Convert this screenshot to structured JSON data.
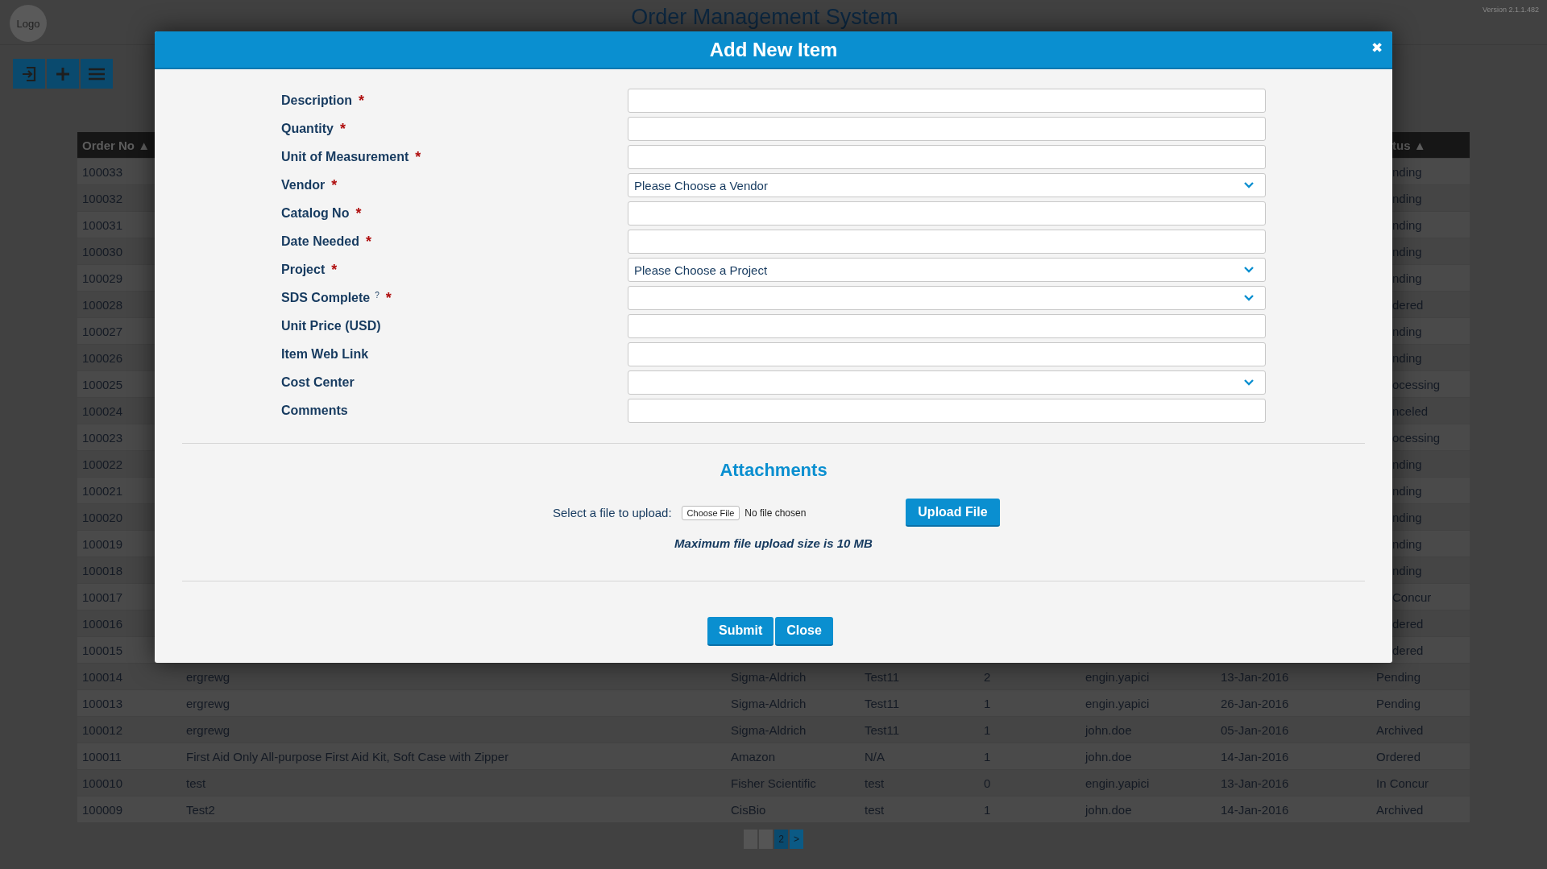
{
  "header": {
    "logo": "Logo",
    "title": "Order Management System",
    "version": "Version 2.1.1.482"
  },
  "toolbar": [
    {
      "kind": "login"
    },
    {
      "kind": "add"
    },
    {
      "kind": "menu"
    }
  ],
  "table": {
    "columns": [
      {
        "label": "Order No",
        "sort": "▲"
      },
      {
        "label": "tus",
        "sort": "▲"
      }
    ],
    "rows": [
      {
        "kind": "covered",
        "order_no": "100033",
        "status": "nding"
      },
      {
        "kind": "covered",
        "order_no": "100032",
        "status": "nding"
      },
      {
        "kind": "covered",
        "order_no": "100031",
        "status": "nding"
      },
      {
        "kind": "covered",
        "order_no": "100030",
        "status": "nding"
      },
      {
        "kind": "covered",
        "order_no": "100029",
        "status": "nding"
      },
      {
        "kind": "covered",
        "order_no": "100028",
        "status": "dered"
      },
      {
        "kind": "covered",
        "order_no": "100027",
        "status": "nding"
      },
      {
        "kind": "covered",
        "order_no": "100026",
        "status": "nding"
      },
      {
        "kind": "covered",
        "order_no": "100025",
        "status": "ocessing"
      },
      {
        "kind": "covered",
        "order_no": "100024",
        "status": "nceled"
      },
      {
        "kind": "covered",
        "order_no": "100023",
        "status": "ocessing"
      },
      {
        "kind": "covered",
        "order_no": "100022",
        "status": "nding"
      },
      {
        "kind": "covered",
        "order_no": "100021",
        "status": "nding"
      },
      {
        "kind": "covered",
        "order_no": "100020",
        "status": "nding"
      },
      {
        "kind": "covered",
        "order_no": "100019",
        "status": "nding"
      },
      {
        "kind": "covered",
        "order_no": "100018",
        "status": "nding"
      },
      {
        "kind": "covered",
        "order_no": "100017",
        "status": "Concur"
      },
      {
        "kind": "covered",
        "order_no": "100016",
        "status": "dered"
      },
      {
        "kind": "covered",
        "order_no": "100015",
        "status": "dered"
      },
      {
        "kind": "full",
        "cells": [
          "100014",
          "ergrewg",
          "Sigma-Aldrich",
          "Test11",
          "2",
          "engin.yapici",
          "13-Jan-2016",
          "Pending"
        ]
      },
      {
        "kind": "full",
        "cells": [
          "100013",
          "ergrewg",
          "Sigma-Aldrich",
          "Test11",
          "1",
          "engin.yapici",
          "26-Jan-2016",
          "Pending"
        ]
      },
      {
        "kind": "full",
        "cells": [
          "100012",
          "ergrewg",
          "Sigma-Aldrich",
          "Test11",
          "1",
          "john.doe",
          "05-Jan-2016",
          "Archived"
        ]
      },
      {
        "kind": "full",
        "cells": [
          "100011",
          "First Aid Only All-purpose First Aid Kit, Soft Case with Zipper",
          "Amazon",
          "N/A",
          "1",
          "john.doe",
          "14-Jan-2016",
          "Ordered"
        ]
      },
      {
        "kind": "full",
        "cells": [
          "100010",
          "test",
          "Fisher Scientific",
          "test",
          "0",
          "engin.yapici",
          "13-Jan-2016",
          "In Concur"
        ]
      },
      {
        "kind": "full",
        "cells": [
          "100009",
          "Test2",
          "CisBio",
          "test",
          "1",
          "john.doe",
          "14-Jan-2016",
          "Archived"
        ]
      }
    ]
  },
  "pagination": [
    {
      "kind": "blank",
      "disabled": true
    },
    {
      "kind": "blank",
      "disabled": true
    },
    {
      "kind": "page",
      "label": "2",
      "selected": true
    },
    {
      "kind": "page",
      "label": ">",
      "selected": false
    }
  ],
  "modal": {
    "title": "Add New Item",
    "close": "✖",
    "required_mark": "*",
    "fields": [
      {
        "label": "Description",
        "kind": "text",
        "required": true
      },
      {
        "label": "Quantity",
        "kind": "text",
        "required": true
      },
      {
        "label": "Unit of Measurement",
        "kind": "text",
        "required": true
      },
      {
        "label": "Vendor",
        "kind": "select",
        "required": true,
        "value": "Please Choose a Vendor"
      },
      {
        "label": "Catalog No",
        "kind": "text",
        "required": true
      },
      {
        "label": "Date Needed",
        "kind": "text",
        "required": true
      },
      {
        "label": "Project",
        "kind": "select",
        "required": true,
        "value": "Please Choose a Project"
      },
      {
        "label": "SDS Complete",
        "kind": "select",
        "required": true,
        "help": "?"
      },
      {
        "label": "Unit Price (USD)",
        "kind": "text",
        "required": false
      },
      {
        "label": "Item Web Link",
        "kind": "text",
        "required": false
      },
      {
        "label": "Cost Center",
        "kind": "select",
        "required": false
      },
      {
        "label": "Comments",
        "kind": "text",
        "required": false
      }
    ],
    "attachments": {
      "heading": "Attachments",
      "label": "Select a file to upload:",
      "choose_button": "Choose File",
      "file_status": "No file chosen",
      "upload_button": "Upload File",
      "note": "Maximum file upload size is 10 MB"
    },
    "buttons": [
      "Submit",
      "Close"
    ]
  }
}
